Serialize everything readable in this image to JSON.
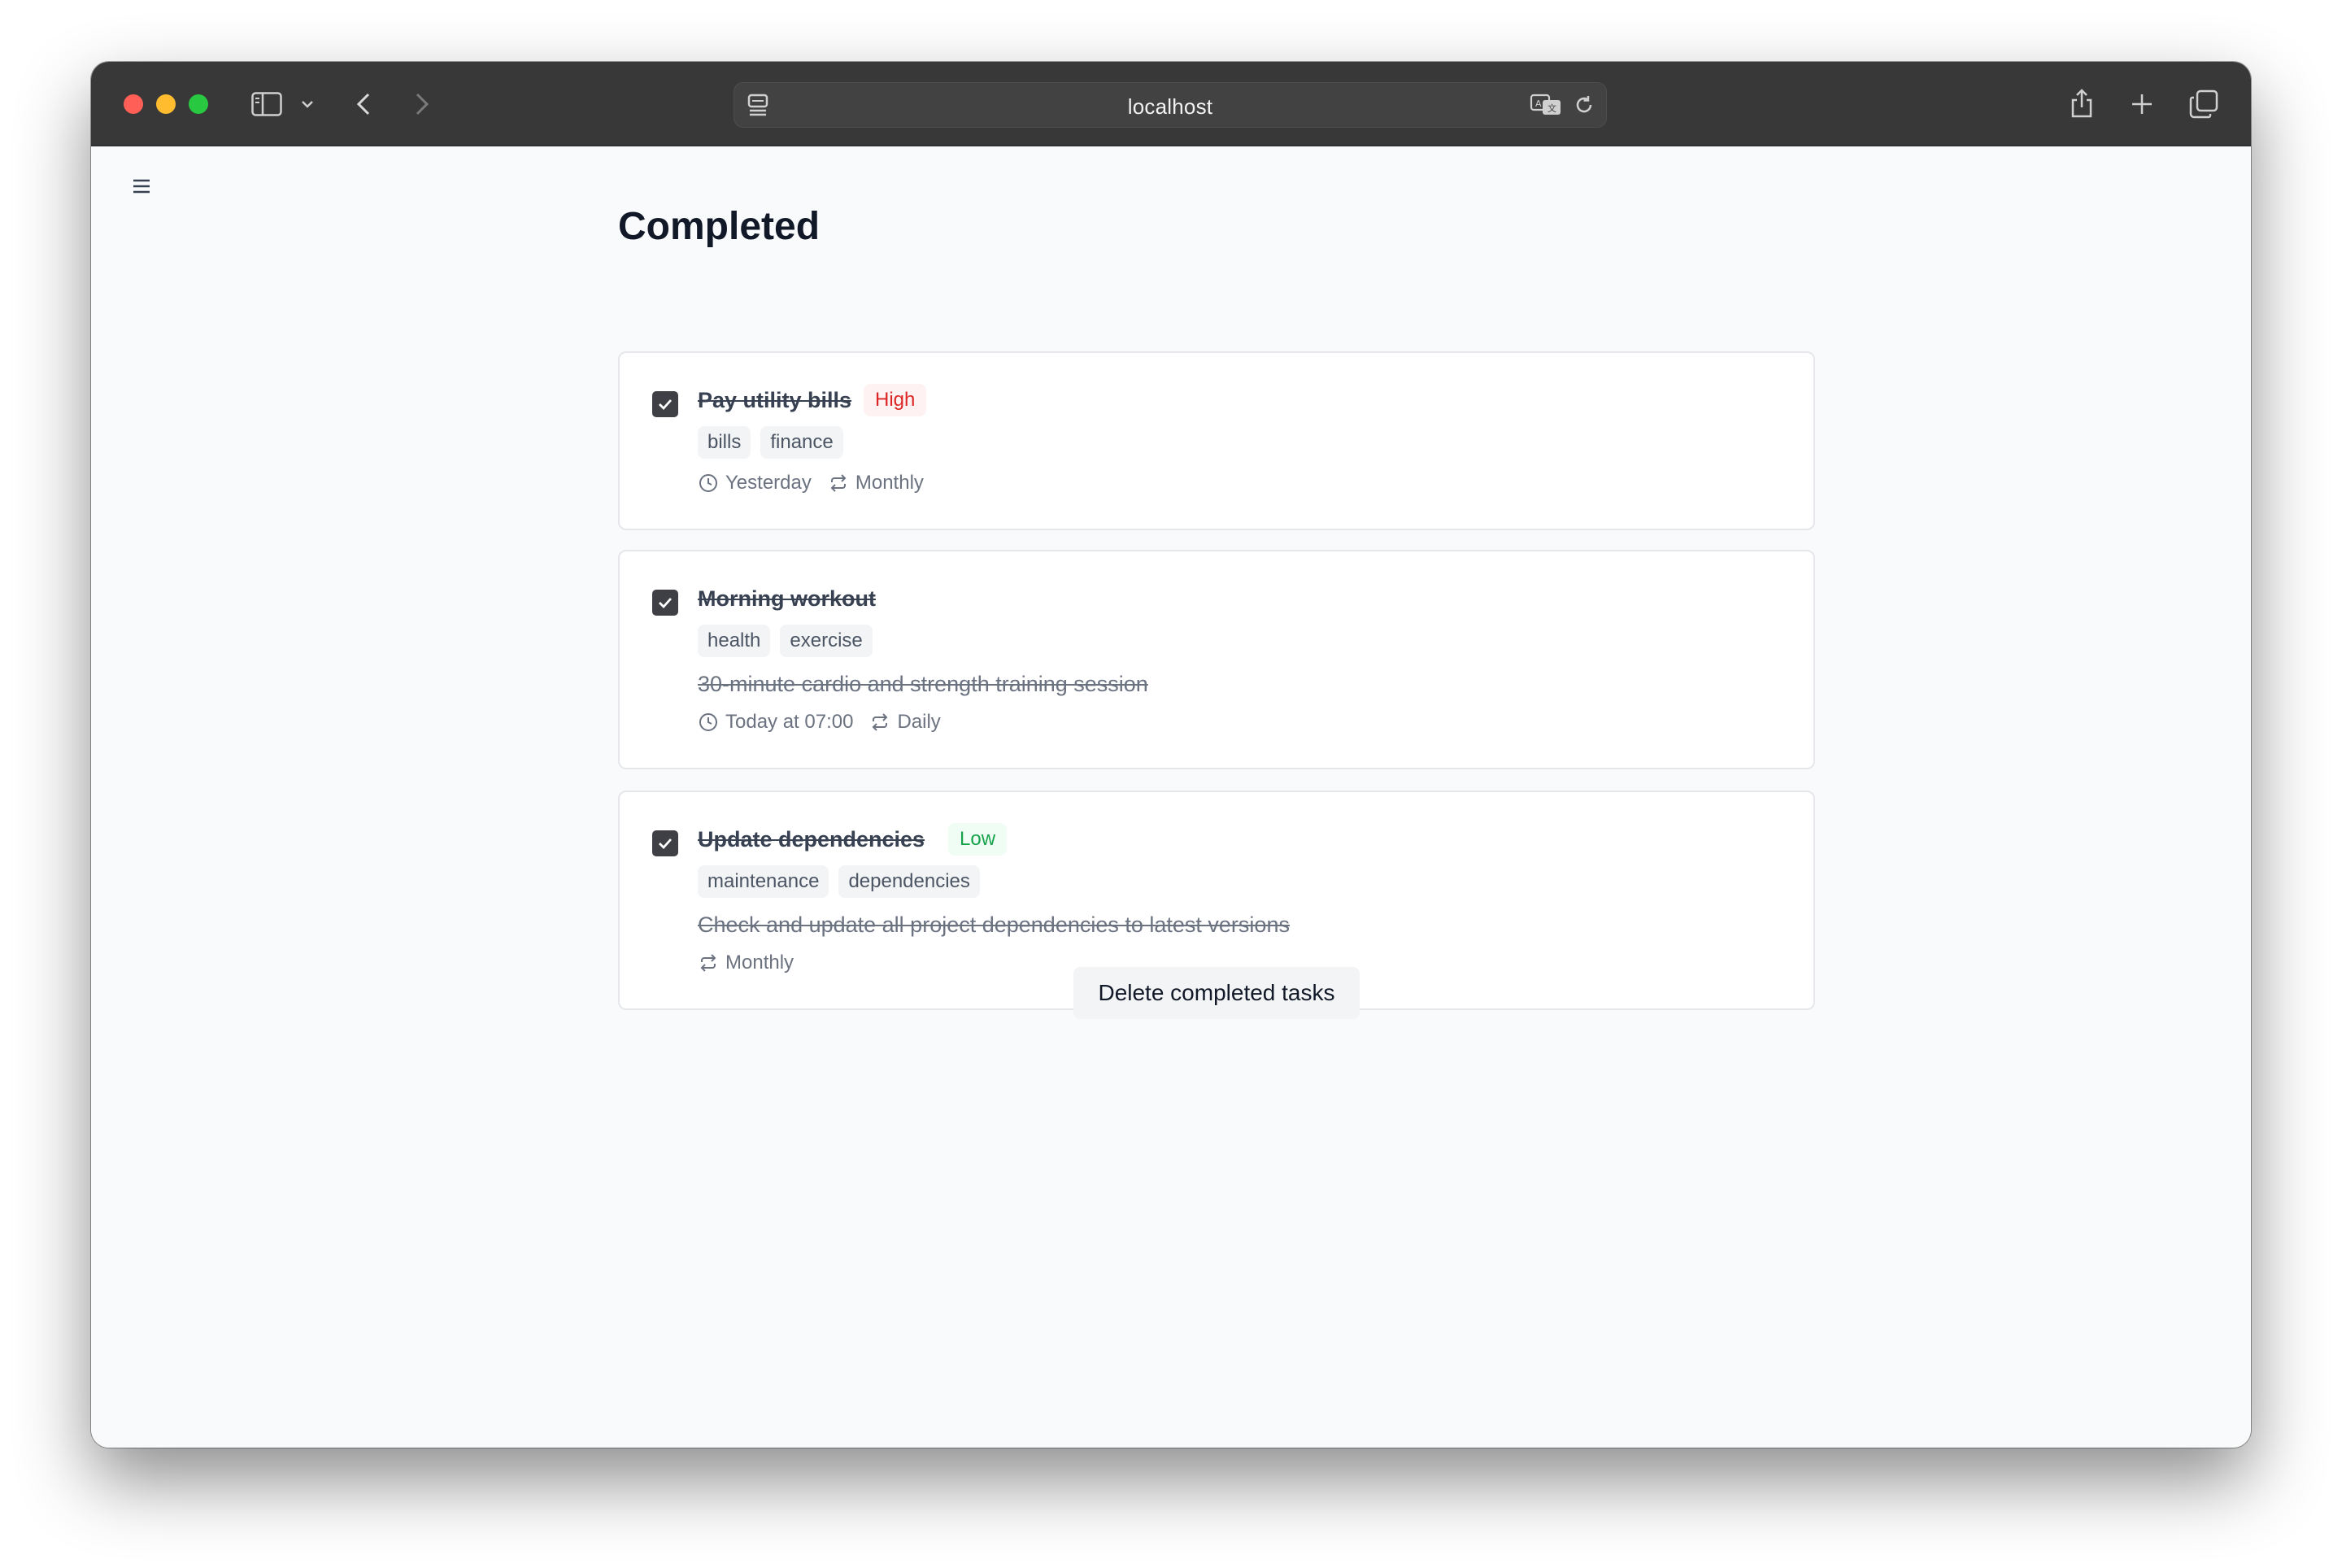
{
  "browser": {
    "address": "localhost"
  },
  "page": {
    "title": "Completed"
  },
  "tasks": [
    {
      "title": "Pay utility bills",
      "priority": "High",
      "tags": [
        "bills",
        "finance"
      ],
      "description": "",
      "due": "Yesterday",
      "repeat": "Monthly"
    },
    {
      "title": "Morning workout",
      "priority": "",
      "tags": [
        "health",
        "exercise"
      ],
      "description": "30-minute cardio and strength training session",
      "due": "Today at 07:00",
      "repeat": "Daily"
    },
    {
      "title": "Update dependencies",
      "priority": "Low",
      "tags": [
        "maintenance",
        "dependencies"
      ],
      "description": "Check and update all project dependencies to latest versions",
      "due": "",
      "repeat": "Monthly"
    }
  ],
  "actions": {
    "delete_completed": "Delete completed tasks"
  },
  "colors": {
    "titlebar": "#383838",
    "priority_high": "#dc2626",
    "priority_low": "#16a34a",
    "checkbox": "#3f3f46"
  }
}
